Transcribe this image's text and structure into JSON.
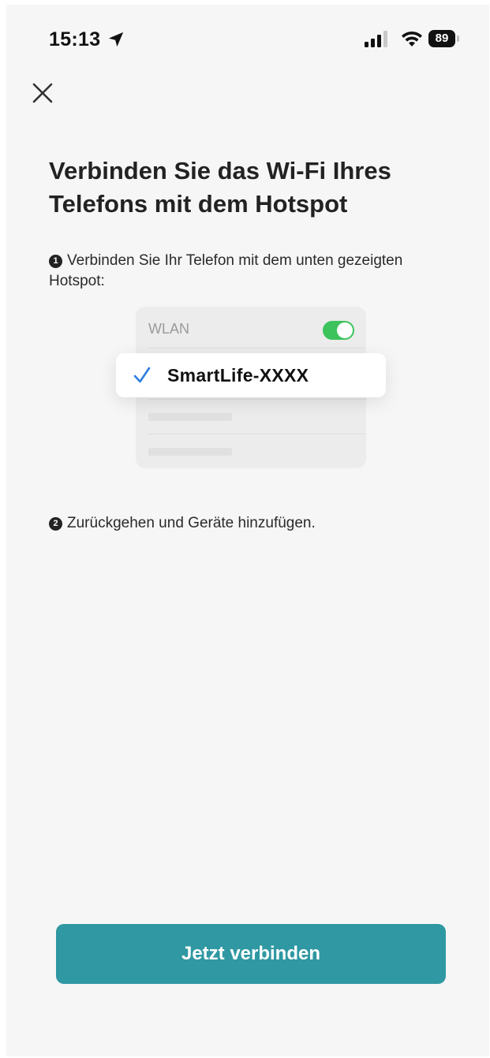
{
  "status_bar": {
    "time": "15:13",
    "battery": "89",
    "icons": [
      "location-arrow-icon",
      "cellular-signal-icon",
      "wifi-icon",
      "battery-icon"
    ]
  },
  "header": {
    "close_icon": "close-x-icon"
  },
  "title": "Verbinden Sie das Wi-Fi Ihres Telefons mit dem Hotspot",
  "steps": [
    {
      "number": "1",
      "text": "Verbinden Sie Ihr Telefon mit dem unten gezeigten Hotspot:"
    },
    {
      "number": "2",
      "text": "Zurückgehen und Geräte hinzufügen."
    }
  ],
  "illustration": {
    "wlan_label": "WLAN",
    "wlan_toggle_on": true,
    "network_name": "SmartLife-XXXX",
    "check_icon": "checkmark-icon"
  },
  "primary_button": {
    "label": "Jetzt verbinden"
  },
  "colors": {
    "accent": "#2f98a2",
    "toggle_on": "#3dc35b",
    "check": "#2f7de0",
    "background": "#f6f6f6"
  }
}
